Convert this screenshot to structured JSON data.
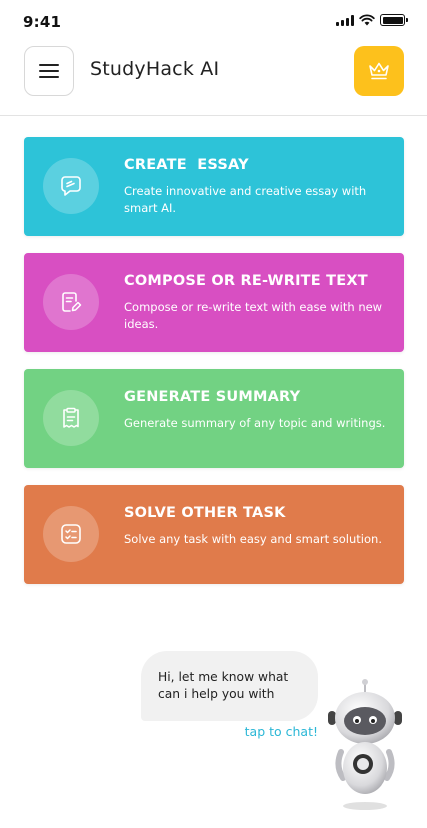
{
  "status_bar": {
    "time": "9:41"
  },
  "header": {
    "title": "StudyHack AI"
  },
  "cards": [
    {
      "title": "CREATE  ESSAY",
      "description": "Create innovative and creative essay with smart AI.",
      "color": "#2DC3D8",
      "icon": "essay-chat-icon"
    },
    {
      "title": "COMPOSE OR RE-WRITE TEXT",
      "description": "Compose or re-write text with ease  with new ideas.",
      "color": "#D84FC2",
      "icon": "compose-document-icon"
    },
    {
      "title": "GENERATE SUMMARY",
      "description": "Generate summary of any topic and writings.",
      "color": "#72D283",
      "icon": "summary-clipboard-icon"
    },
    {
      "title": "SOLVE OTHER TASK",
      "description": "Solve any task with easy and smart solution.",
      "color": "#E07B4B",
      "icon": "task-checklist-icon"
    }
  ],
  "chat": {
    "message": "Hi, let me know what can i help you with",
    "tap_label": "tap to chat!"
  },
  "colors": {
    "accent_yellow": "#FDC11C",
    "link_blue": "#2BB7D6"
  }
}
